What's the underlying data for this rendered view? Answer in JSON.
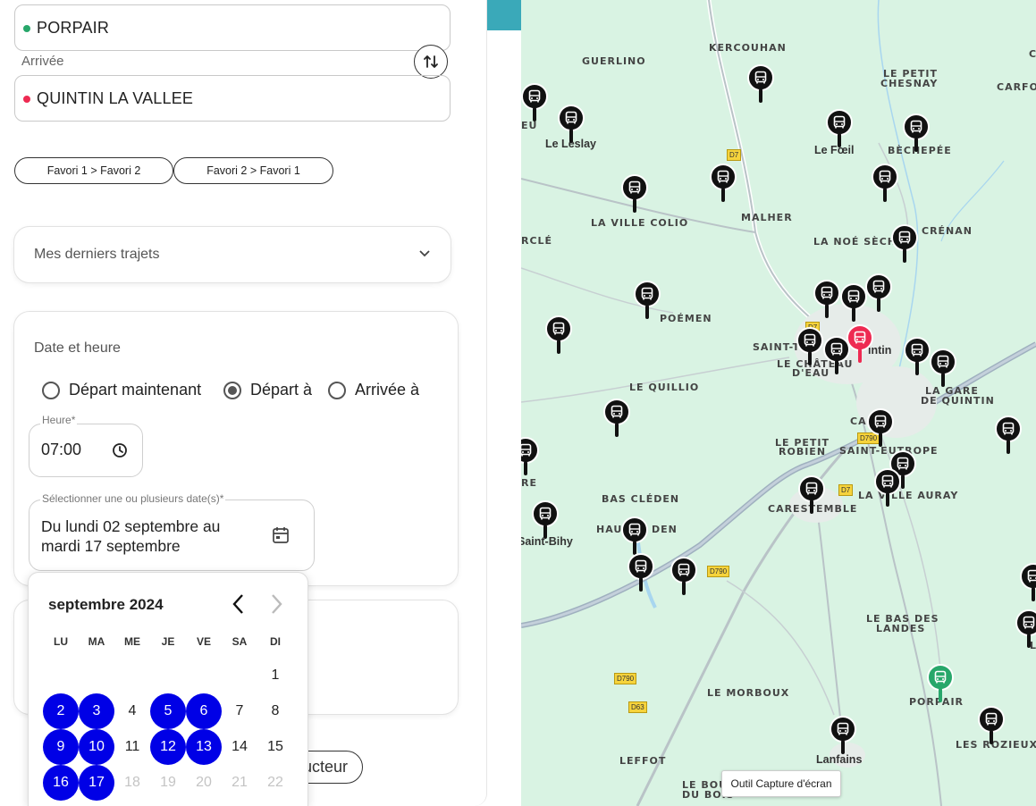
{
  "departure": {
    "value": "PORPAIR",
    "dot_color": "#27a76a"
  },
  "arrival": {
    "label": "Arrivée",
    "value": "QUINTIN LA VALLEE",
    "dot_color": "#ee2a52"
  },
  "favorites": [
    "Favori 1 > Favori 2",
    "Favori 2 > Favori 1"
  ],
  "recent_trips": {
    "label": "Mes derniers trajets"
  },
  "datetime": {
    "title": "Date et heure",
    "options": [
      {
        "label": "Départ maintenant",
        "selected": false
      },
      {
        "label": "Départ à",
        "selected": true
      },
      {
        "label": "Arrivée à",
        "selected": false
      }
    ],
    "hour_label": "Heure",
    "hour_value": "07:00",
    "dates_label": "Sélectionner une ou plusieurs date(s)",
    "dates_line1": "Du lundi 02 septembre au",
    "dates_line2": "mardi 17 septembre"
  },
  "hidden_button": {
    "label": "ucteur"
  },
  "calendar": {
    "month": "septembre 2024",
    "weekdays": [
      "LU",
      "MA",
      "ME",
      "JE",
      "VE",
      "SA",
      "DI"
    ],
    "selected_days": [
      2,
      3,
      5,
      6,
      9,
      10,
      12,
      13,
      16,
      17
    ],
    "disabled_from": 18,
    "visible_days_last": 22
  },
  "map": {
    "labels": [
      "KERCOUHAN",
      "GUERLINO",
      "LE PETIT",
      "CHESNAY",
      "CARFOT",
      "CAR",
      "Le Leslay",
      "Le Fœil",
      "BÈCHEPÉE",
      "LA VILLE COLIO",
      "MALHER",
      "CRÉNAN",
      "LA NOÉ SÈCHE",
      "RCLÉ",
      "POÉMEN",
      "SAINT-T",
      "LE CHÂTEAU",
      "D'EAU",
      "intin",
      "LA GARE",
      "DE QUINTIN",
      "LE QUILLIO",
      "CA",
      "LE PETIT",
      "ROBIEN",
      "SAINT-EUTROPE",
      "BAS CLÉDEN",
      "CARESTEMBLE",
      "LA VILLE AURAY",
      "HAUT",
      "DEN",
      "Saint-Bihy",
      "RE",
      "EU",
      "LE BAS DES",
      "LANDES",
      "LE MORBOUX",
      "PORPAIR",
      "LES ROZIEUX",
      "LEFFOT",
      "Lanfains",
      "LE BOUT",
      "DU BOIS",
      "LE P"
    ],
    "road_signs": [
      "D7",
      "D7",
      "D790",
      "D7",
      "D790",
      "D790",
      "D63"
    ],
    "tooltip": "Outil Capture d'écran"
  }
}
